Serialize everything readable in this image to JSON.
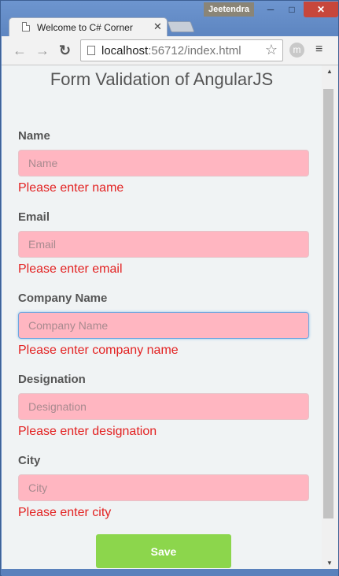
{
  "window": {
    "user": "Jeetendra",
    "minimize": "─",
    "maximize": "□",
    "close": "✕"
  },
  "tab": {
    "title": "Welcome to C# Corner",
    "close": "✕"
  },
  "toolbar": {
    "back": "←",
    "forward": "→",
    "reload": "↻",
    "url_host": "localhost",
    "url_rest": ":56712/index.html",
    "star": "☆",
    "extension": "m",
    "menu": "≡"
  },
  "page": {
    "title": "Form Validation of AngularJS",
    "fields": [
      {
        "label": "Name",
        "placeholder": "Name",
        "error": "Please enter name"
      },
      {
        "label": "Email",
        "placeholder": "Email",
        "error": "Please enter email"
      },
      {
        "label": "Company Name",
        "placeholder": "Company Name",
        "error": "Please enter company name"
      },
      {
        "label": "Designation",
        "placeholder": "Designation",
        "error": "Please enter designation"
      },
      {
        "label": "City",
        "placeholder": "City",
        "error": "Please enter city"
      }
    ],
    "save_label": "Save"
  },
  "scrollbar": {
    "up": "▲",
    "down": "▼"
  },
  "colors": {
    "input_invalid_bg": "#ffb6c1",
    "error_text": "#e32222",
    "save_button": "#8cd64c",
    "page_bg": "#f0f3f4"
  }
}
